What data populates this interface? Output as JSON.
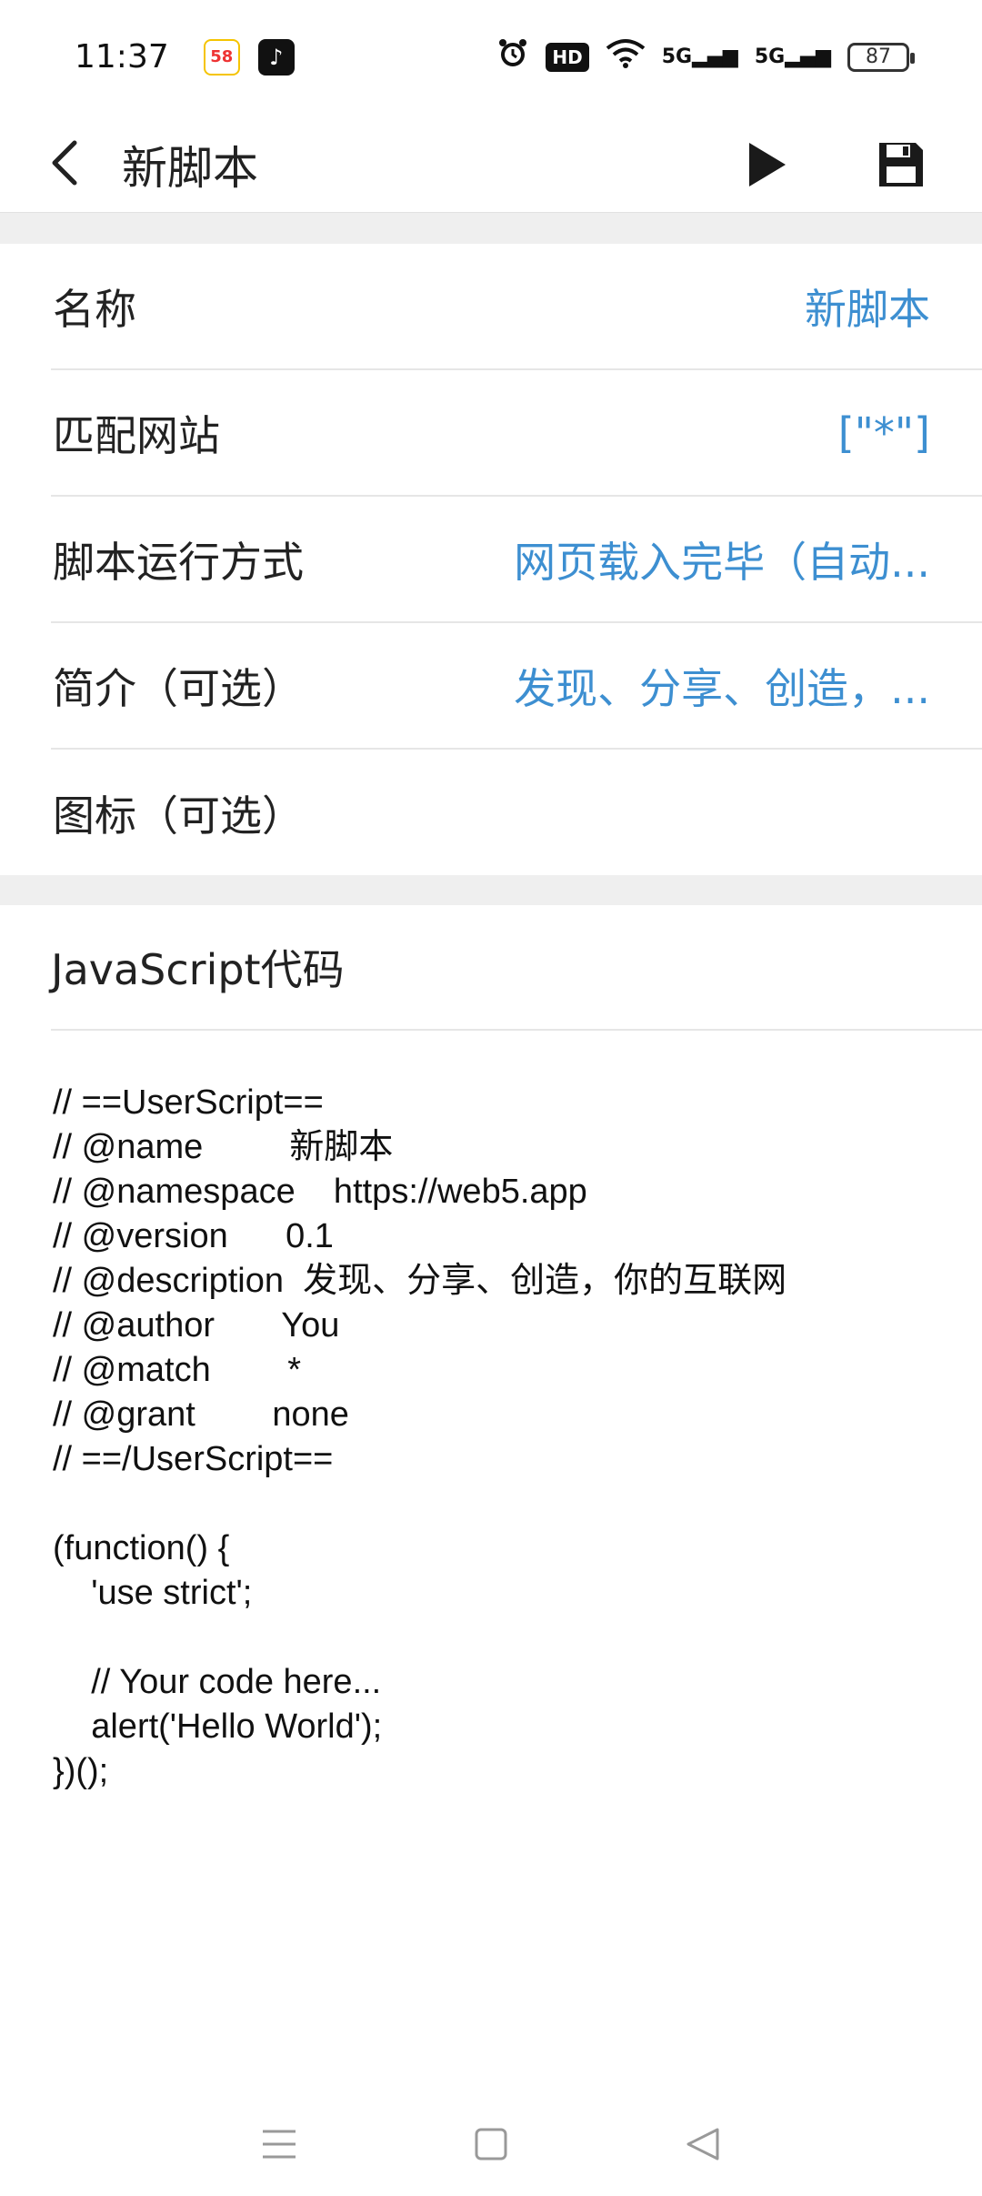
{
  "status_bar": {
    "time": "11:37",
    "app_icons": [
      "58",
      "♪"
    ],
    "hd_label": "HD",
    "signal_1": "5G",
    "signal_2": "5G",
    "battery": "87"
  },
  "app_bar": {
    "title": "新脚本"
  },
  "form": {
    "rows": [
      {
        "label": "名称",
        "value": "新脚本"
      },
      {
        "label": "匹配网站",
        "value": "[\"*\"]"
      },
      {
        "label": "脚本运行方式",
        "value": "网页载入完毕（自动..."
      },
      {
        "label": "简介（可选）",
        "value": "发现、分享、创造，..."
      },
      {
        "label": "图标（可选）",
        "value": ""
      }
    ]
  },
  "code_section": {
    "header": "JavaScript代码",
    "lines": [
      "// ==UserScript==",
      "// @name         新脚本",
      "// @namespace    https://web5.app",
      "// @version      0.1",
      "// @description  发现、分享、创造，你的互联网",
      "// @author       You",
      "// @match        *",
      "// @grant        none",
      "// ==/UserScript==",
      "",
      "(function() {",
      "    'use strict';",
      "",
      "    // Your code here...",
      "    alert('Hello World');",
      "})();"
    ]
  },
  "colors": {
    "accent": "#3d8fd1",
    "divider": "#e6e6e6",
    "band": "#efefef"
  },
  "icons": {
    "back": "chevron-left-icon",
    "run": "play-icon",
    "save": "floppy-disk-icon",
    "nav_menu": "menu-icon",
    "nav_home": "home-square-icon",
    "nav_back": "triangle-back-icon"
  }
}
